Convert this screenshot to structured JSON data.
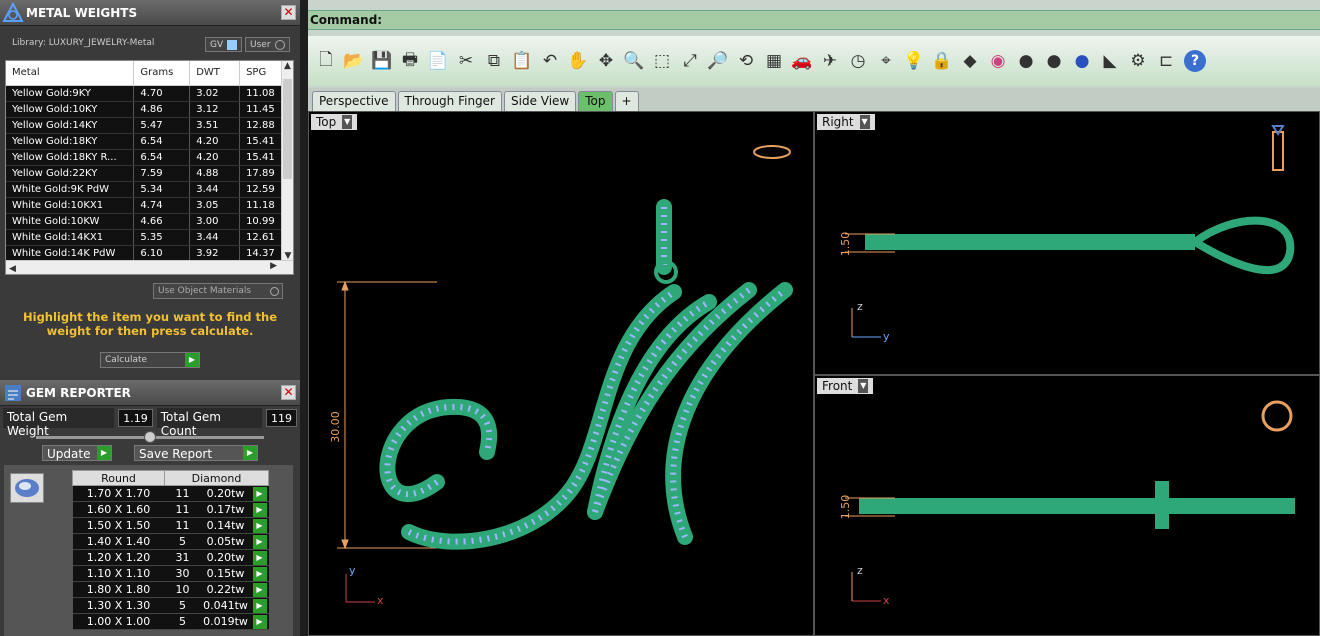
{
  "metal_panel": {
    "title": "METAL WEIGHTS",
    "close": "✕",
    "library": "Library: LUXURY_JEWELRY-Metal",
    "gv": "GV",
    "user": "User",
    "columns": [
      "Metal",
      "Grams",
      "DWT",
      "SPG"
    ],
    "rows": [
      [
        "Yellow Gold:9KY",
        "4.70",
        "3.02",
        "11.08"
      ],
      [
        "Yellow Gold:10KY",
        "4.86",
        "3.12",
        "11.45"
      ],
      [
        "Yellow Gold:14KY",
        "5.47",
        "3.51",
        "12.88"
      ],
      [
        "Yellow Gold:18KY",
        "6.54",
        "4.20",
        "15.41"
      ],
      [
        "Yellow Gold:18KY R...",
        "6.54",
        "4.20",
        "15.41"
      ],
      [
        "Yellow Gold:22KY",
        "7.59",
        "4.88",
        "17.89"
      ],
      [
        "White Gold:9K PdW",
        "5.34",
        "3.44",
        "12.59"
      ],
      [
        "White Gold:10KX1",
        "4.74",
        "3.05",
        "11.18"
      ],
      [
        "White Gold:10KW",
        "4.66",
        "3.00",
        "10.99"
      ],
      [
        "White Gold:14KX1",
        "5.35",
        "3.44",
        "12.61"
      ],
      [
        "White Gold:14K PdW",
        "6.10",
        "3.92",
        "14.37"
      ]
    ],
    "use_object": "Use Object Materials",
    "hint": "Highlight the item you want to find the weight for then press calculate.",
    "calculate": "Calculate"
  },
  "gem_panel": {
    "title": "GEM REPORTER",
    "close": "✕",
    "total_weight_label": "Total Gem Weight",
    "total_weight": "1.19",
    "total_count_label": "Total Gem Count",
    "total_count": "119",
    "update": "Update",
    "save": "Save Report",
    "shape": "Round",
    "stone": "Diamond",
    "rows": [
      [
        "1.70 X 1.70",
        "11",
        "0.20tw"
      ],
      [
        "1.60 X 1.60",
        "11",
        "0.17tw"
      ],
      [
        "1.50 X 1.50",
        "11",
        "0.14tw"
      ],
      [
        "1.40 X 1.40",
        "5",
        "0.05tw"
      ],
      [
        "1.20 X 1.20",
        "31",
        "0.20tw"
      ],
      [
        "1.10 X 1.10",
        "30",
        "0.15tw"
      ],
      [
        "1.80 X 1.80",
        "10",
        "0.22tw"
      ],
      [
        "1.30 X 1.30",
        "5",
        "0.041tw"
      ],
      [
        "1.00 X 1.00",
        "5",
        "0.019tw"
      ]
    ]
  },
  "command": {
    "label": "Command:"
  },
  "toolbar": {
    "icons": [
      "new-icon",
      "open-icon",
      "save-icon",
      "print-icon",
      "import-icon",
      "cut-icon",
      "copy-icon",
      "paste-icon",
      "undo-icon",
      "pan-icon",
      "rotate-icon",
      "zoom-icon",
      "zoom-window-icon",
      "zoom-extents-icon",
      "zoom-selected-icon",
      "rotate-view-icon",
      "viewport-layout-icon",
      "car-icon",
      "plane-icon",
      "clock-icon",
      "snap-icon",
      "light-icon",
      "lock-icon",
      "material-icon",
      "color-icon",
      "sphere-gray-icon",
      "sphere-render-icon",
      "sphere-blue-icon",
      "spotlight-icon",
      "gear-icon",
      "dimension-icon",
      "help-icon"
    ],
    "glyphs": [
      "🗋",
      "📂",
      "💾",
      "🖶",
      "📄",
      "✂",
      "⧉",
      "📋",
      "↶",
      "✋",
      "✥",
      "🔍",
      "⬚",
      "⤢",
      "🔎",
      "⟲",
      "▦",
      "🚗",
      "✈",
      "◷",
      "⌖",
      "💡",
      "🔒",
      "◆",
      "◉",
      "●",
      "●",
      "●",
      "◣",
      "⚙",
      "⊏",
      "?"
    ]
  },
  "tabs": [
    "Perspective",
    "Through Finger",
    "Side View",
    "Top",
    "+"
  ],
  "viewports": {
    "top": {
      "label": "Top",
      "dim": "30.00",
      "axis_x": "x",
      "axis_y": "y"
    },
    "right": {
      "label": "Right",
      "dim": "1.50",
      "axis_x": "y",
      "axis_y": "z"
    },
    "front": {
      "label": "Front",
      "dim": "1.50",
      "axis_x": "x",
      "axis_y": "z"
    }
  },
  "colors": {
    "metal": "#2ea878",
    "gem": "#9fb6ff",
    "accent": "#6bbf6b",
    "dimension": "#e8a060"
  }
}
